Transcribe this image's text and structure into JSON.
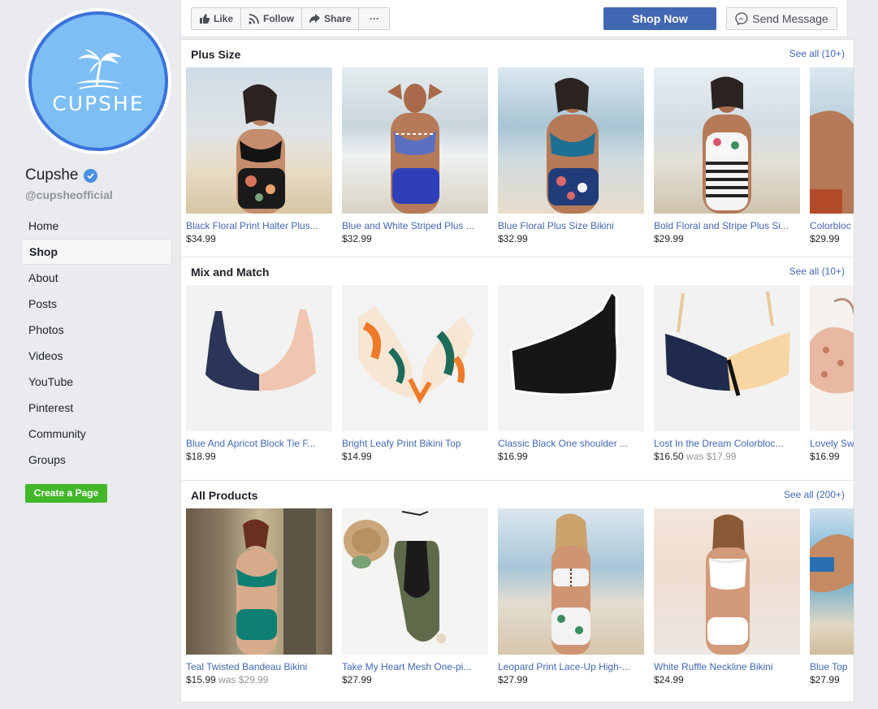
{
  "page": {
    "avatar_text": "CUPSHE",
    "name": "Cupshe",
    "handle": "@cupsheofficial"
  },
  "nav": {
    "items": [
      {
        "label": "Home"
      },
      {
        "label": "Shop",
        "active": true
      },
      {
        "label": "About"
      },
      {
        "label": "Posts"
      },
      {
        "label": "Photos"
      },
      {
        "label": "Videos"
      },
      {
        "label": "YouTube"
      },
      {
        "label": "Pinterest"
      },
      {
        "label": "Community"
      },
      {
        "label": "Groups"
      }
    ],
    "create_page": "Create a Page"
  },
  "actions": {
    "like": "Like",
    "follow": "Follow",
    "share": "Share",
    "more": "···",
    "shop_now": "Shop Now",
    "send_message": "Send Message"
  },
  "sections": [
    {
      "title": "Plus Size",
      "see_all": "See all (10+)",
      "products": [
        {
          "name": "Black Floral Print Halter Plus...",
          "price": "$34.99",
          "was": ""
        },
        {
          "name": "Blue and White Striped Plus ...",
          "price": "$32.99",
          "was": ""
        },
        {
          "name": "Blue Floral Plus Size Bikini",
          "price": "$32.99",
          "was": ""
        },
        {
          "name": "Bold Floral and Stripe Plus Si...",
          "price": "$29.99",
          "was": ""
        },
        {
          "name": "Colorbloc",
          "price": "$29.99",
          "was": ""
        }
      ]
    },
    {
      "title": "Mix and Match",
      "see_all": "See all (10+)",
      "products": [
        {
          "name": "Blue And Apricot Block Tie F...",
          "price": "$18.99",
          "was": ""
        },
        {
          "name": "Bright Leafy Print Bikini Top",
          "price": "$14.99",
          "was": ""
        },
        {
          "name": "Classic Black One shoulder ...",
          "price": "$16.99",
          "was": ""
        },
        {
          "name": "Lost In the Dream Colorbloc...",
          "price": "$16.50",
          "was": "was $17.99"
        },
        {
          "name": "Lovely Sw",
          "price": "$16.99",
          "was": ""
        }
      ]
    },
    {
      "title": "All Products",
      "see_all": "See all (200+)",
      "products": [
        {
          "name": "Teal Twisted Bandeau Bikini",
          "price": "$15.99",
          "was": "was $29.99"
        },
        {
          "name": "Take My Heart Mesh One-pi...",
          "price": "$27.99",
          "was": ""
        },
        {
          "name": "Leopard Print Lace-Up High-...",
          "price": "$27.99",
          "was": ""
        },
        {
          "name": "White Ruffle Neckline Bikini",
          "price": "$24.99",
          "was": ""
        },
        {
          "name": "Blue Top",
          "price": "$27.99",
          "was": ""
        }
      ]
    }
  ],
  "colors": {
    "link": "#4267b2",
    "shop_now_bg": "#4267b2",
    "create_page_bg": "#42b72a",
    "avatar_bg": "#7dbef5",
    "avatar_ring": "#3b72d9"
  }
}
